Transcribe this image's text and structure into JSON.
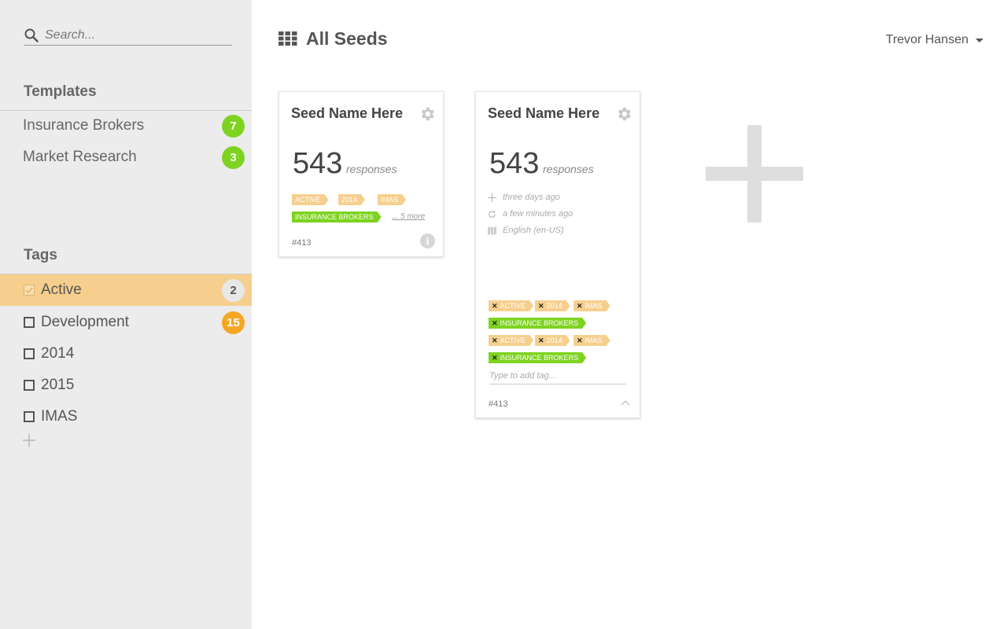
{
  "sidebar": {
    "search": {
      "placeholder": "Search..."
    },
    "templates": {
      "title": "Templates",
      "items": [
        {
          "label": "Insurance Brokers",
          "count": "7"
        },
        {
          "label": "Market Research",
          "count": "3"
        }
      ]
    },
    "tags": {
      "title": "Tags",
      "items": [
        {
          "label": "Active",
          "count": "2",
          "checked": true
        },
        {
          "label": "Development",
          "count": "15",
          "checked": false
        },
        {
          "label": "2014",
          "checked": false
        },
        {
          "label": "2015",
          "checked": false
        },
        {
          "label": "IMAS",
          "checked": false
        }
      ]
    }
  },
  "header": {
    "title": "All Seeds",
    "user_name": "Trevor Hansen"
  },
  "cards": [
    {
      "name": "Seed Name Here",
      "responses_count": "543",
      "responses_label": "responses",
      "tags": [
        "ACTIVE",
        "2014",
        "IMAS",
        "INSURANCE BROKERS"
      ],
      "more_label": "... 5 more",
      "id": "#413"
    },
    {
      "name": "Seed Name Here",
      "responses_count": "543",
      "responses_label": "responses",
      "created": "three days ago",
      "updated": "a few minutes ago",
      "language": "English (en-US)",
      "tags_group_1": [
        "ACTIVE",
        "2014",
        "IMAS",
        "INSURANCE BROKERS"
      ],
      "tags_group_2": [
        "ACTIVE",
        "2014",
        "IMAS",
        "INSURANCE BROKERS"
      ],
      "tag_input_placeholder": "Type to add tag...",
      "id": "#413"
    }
  ],
  "colors": {
    "sidebar_bg": "#ececec",
    "active_tag_bg": "#f6cf8e",
    "green": "#7ed321",
    "orange": "#f5a623",
    "tag_orange": "#f6cf8e"
  },
  "icons": {
    "search": "search-icon",
    "grid": "grid-icon",
    "gear": "gear-icon",
    "info": "info-icon",
    "plus": "plus-icon",
    "refresh": "refresh-icon",
    "map": "map-icon",
    "caret": "caret-down-icon",
    "chevron_up": "chevron-up-icon",
    "close": "close-icon",
    "check": "check-icon"
  }
}
